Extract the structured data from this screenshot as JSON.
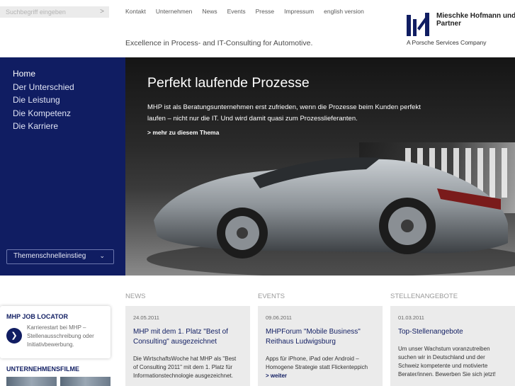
{
  "search": {
    "placeholder": "Suchbegriff eingeben",
    "icon": "chevron-right-icon"
  },
  "topnav": [
    "Kontakt",
    "Unternehmen",
    "News",
    "Events",
    "Presse",
    "Impressum",
    "english version"
  ],
  "tagline": "Excellence in Process- and IT-Consulting for Automotive.",
  "logo": {
    "name": "Mieschke Hofmann und Partner",
    "sub": "A Porsche Services Company",
    "color": "#101d62"
  },
  "sidenav": {
    "items": [
      "Home",
      "Der Unterschied",
      "Die Leistung",
      "Die Kompetenz",
      "Die Karriere"
    ],
    "quick": "Themenschnelleinstieg"
  },
  "hero": {
    "title": "Perfekt laufende Prozesse",
    "text": "MHP ist als Beratungsunternehmen erst zufrieden, wenn die Prozesse beim Kunden perfekt laufen – nicht nur die IT. Und wird damit quasi zum Prozesslieferanten.",
    "link": "> mehr zu diesem Thema"
  },
  "joblocator": {
    "title": "MHP JOB LOCATOR",
    "text": "Karrierestart bei MHP – Stellenausschreibung oder Initiativbewerbung."
  },
  "films": {
    "title": "UNTERNEHMENSFILME"
  },
  "columns": [
    {
      "title": "NEWS",
      "date": "24.05.2011",
      "headline": "MHP mit dem 1. Platz \"Best of Consulting\" ausgezeichnet",
      "text": "Die WirtschaftsWoche hat MHP als \"Best of Consulting 2011\" mit dem 1. Platz für Informationstechnologie ausgezeichnet.",
      "more": ""
    },
    {
      "title": "EVENTS",
      "date": "09.06.2011",
      "headline": "MHPForum \"Mobile Business\" Reithaus Ludwigsburg",
      "text": "Apps für iPhone, iPad oder Android – Homogene Strategie statt Flickenteppich",
      "more": "> weiter"
    },
    {
      "title": "STELLENANGEBOTE",
      "date": "01.03.2011",
      "headline": "Top-Stellenangebote",
      "text": "Um unser Wachstum voranzutreiben suchen wir in Deutschland und der Schweiz kompetente und motivierte Berater/innen. Bewerben Sie sich jetzt!",
      "more": ""
    }
  ]
}
